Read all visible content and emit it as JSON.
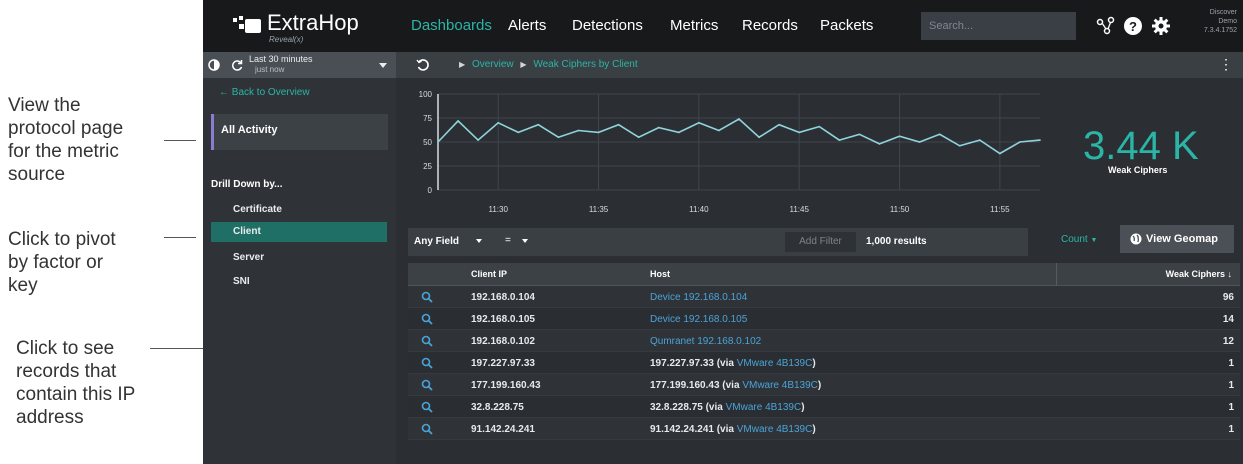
{
  "callouts": [
    {
      "text": "View the\nprotocol page\nfor the metric\nsource"
    },
    {
      "text": "Click to pivot\nby factor or\nkey"
    },
    {
      "text": "Click to see\nrecords that\ncontain this IP\naddress"
    }
  ],
  "brand": {
    "name": "ExtraHop",
    "subtitle": "Reveal(x)"
  },
  "nav": {
    "items": [
      "Dashboards",
      "Alerts",
      "Detections",
      "Metrics",
      "Records",
      "Packets"
    ],
    "active": "Dashboards"
  },
  "search": {
    "placeholder": "Search..."
  },
  "version": {
    "text": "Discover\nDemo\n7.3.4.1752"
  },
  "timebar": {
    "range": "Last 30 minutes",
    "sub": "just now"
  },
  "breadcrumb": {
    "items": [
      "Overview",
      "Weak Ciphers by Client"
    ]
  },
  "sidebar": {
    "back": "Back to Overview",
    "all_activity": "All Activity",
    "drill_label": "Drill Down by...",
    "items": [
      {
        "label": "Certificate",
        "active": false
      },
      {
        "label": "Client",
        "active": true
      },
      {
        "label": "Server",
        "active": false
      },
      {
        "label": "SNI",
        "active": false
      }
    ]
  },
  "chart_data": {
    "type": "line",
    "title": "",
    "xlabel": "",
    "ylabel": "",
    "ylim": [
      0,
      100
    ],
    "yticks": [
      0,
      25,
      50,
      75,
      100
    ],
    "xticks": [
      "11:30",
      "11:35",
      "11:40",
      "11:45",
      "11:50",
      "11:55"
    ],
    "x": [
      "11:27",
      "11:28",
      "11:29",
      "11:30",
      "11:31",
      "11:32",
      "11:33",
      "11:34",
      "11:35",
      "11:36",
      "11:37",
      "11:38",
      "11:39",
      "11:40",
      "11:41",
      "11:42",
      "11:43",
      "11:44",
      "11:45",
      "11:46",
      "11:47",
      "11:48",
      "11:49",
      "11:50",
      "11:51",
      "11:52",
      "11:53",
      "11:54",
      "11:55",
      "11:56",
      "11:57"
    ],
    "series": [
      {
        "values": [
          50,
          72,
          52,
          70,
          60,
          68,
          55,
          62,
          60,
          68,
          55,
          65,
          60,
          70,
          62,
          74,
          55,
          68,
          60,
          66,
          52,
          58,
          48,
          56,
          50,
          58,
          46,
          52,
          38,
          50,
          52
        ]
      }
    ],
    "grid": true,
    "line_color": "#8fd3dc"
  },
  "kpi": {
    "value": "3.44 K",
    "label": "Weak Ciphers"
  },
  "filter": {
    "field": "Any Field",
    "operator": "=",
    "add_filter": "Add Filter",
    "results": "1,000 results"
  },
  "count_button": "Count",
  "geomap_button": "View Geomap",
  "table": {
    "headers": {
      "ip": "Client IP",
      "host": "Host",
      "value": "Weak Ciphers ↓"
    },
    "rows": [
      {
        "ip": "192.168.0.104",
        "host_prefix": "",
        "host_link": "Device 192.168.0.104",
        "host_suffix": "",
        "value": "96"
      },
      {
        "ip": "192.168.0.105",
        "host_prefix": "",
        "host_link": "Device 192.168.0.105",
        "host_suffix": "",
        "value": "14"
      },
      {
        "ip": "192.168.0.102",
        "host_prefix": "",
        "host_link": "Qumranet 192.168.0.102",
        "host_suffix": "",
        "value": "12"
      },
      {
        "ip": "197.227.97.33",
        "host_prefix": "197.227.97.33 (via ",
        "host_link": "VMware 4B139C",
        "host_suffix": ")",
        "value": "1"
      },
      {
        "ip": "177.199.160.43",
        "host_prefix": "177.199.160.43 (via ",
        "host_link": "VMware 4B139C",
        "host_suffix": ")",
        "value": "1"
      },
      {
        "ip": "32.8.228.75",
        "host_prefix": "32.8.228.75 (via ",
        "host_link": "VMware 4B139C",
        "host_suffix": ")",
        "value": "1"
      },
      {
        "ip": "91.142.24.241",
        "host_prefix": "91.142.24.241 (via ",
        "host_link": "VMware 4B139C",
        "host_suffix": ")",
        "value": "1"
      }
    ]
  }
}
